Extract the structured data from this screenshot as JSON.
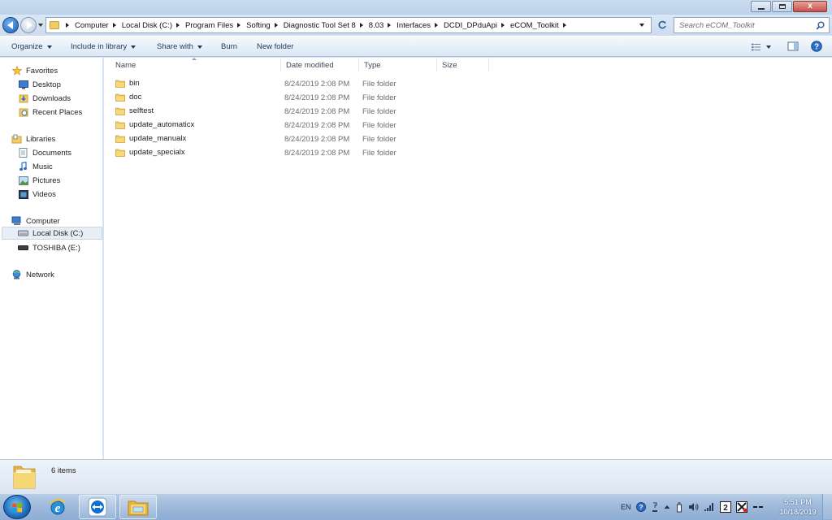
{
  "window": {
    "minimize": "–",
    "maximize": "□",
    "close": "x"
  },
  "address": {
    "crumbs": [
      "Computer",
      "Local Disk (C:)",
      "Program Files",
      "Softing",
      "Diagnostic Tool Set 8",
      "8.03",
      "Interfaces",
      "DCDI_DPduApi",
      "eCOM_Toolkit"
    ]
  },
  "search": {
    "placeholder": "Search eCOM_Toolkit"
  },
  "toolbar": {
    "organize": "Organize",
    "include_in_library": "Include in library",
    "share_with": "Share with",
    "burn": "Burn",
    "new_folder": "New folder"
  },
  "sidebar": {
    "favorites": "Favorites",
    "desktop": "Desktop",
    "downloads": "Downloads",
    "recent_places": "Recent Places",
    "libraries": "Libraries",
    "documents": "Documents",
    "music": "Music",
    "pictures": "Pictures",
    "videos": "Videos",
    "computer": "Computer",
    "local_disk": "Local Disk (C:)",
    "toshiba": "TOSHIBA (E:)",
    "network": "Network"
  },
  "columns": {
    "name": "Name",
    "date_modified": "Date modified",
    "type": "Type",
    "size": "Size"
  },
  "files": [
    {
      "name": "bin",
      "date": "8/24/2019 2:08 PM",
      "type": "File folder"
    },
    {
      "name": "doc",
      "date": "8/24/2019 2:08 PM",
      "type": "File folder"
    },
    {
      "name": "selftest",
      "date": "8/24/2019 2:08 PM",
      "type": "File folder"
    },
    {
      "name": "update_automaticx",
      "date": "8/24/2019 2:08 PM",
      "type": "File folder"
    },
    {
      "name": "update_manualx",
      "date": "8/24/2019 2:08 PM",
      "type": "File folder"
    },
    {
      "name": "update_specialx",
      "date": "8/24/2019 2:08 PM",
      "type": "File folder"
    }
  ],
  "details": {
    "count": "6 items"
  },
  "taskbar": {
    "language": "EN",
    "time": "5:51 PM",
    "date": "10/18/2019"
  }
}
